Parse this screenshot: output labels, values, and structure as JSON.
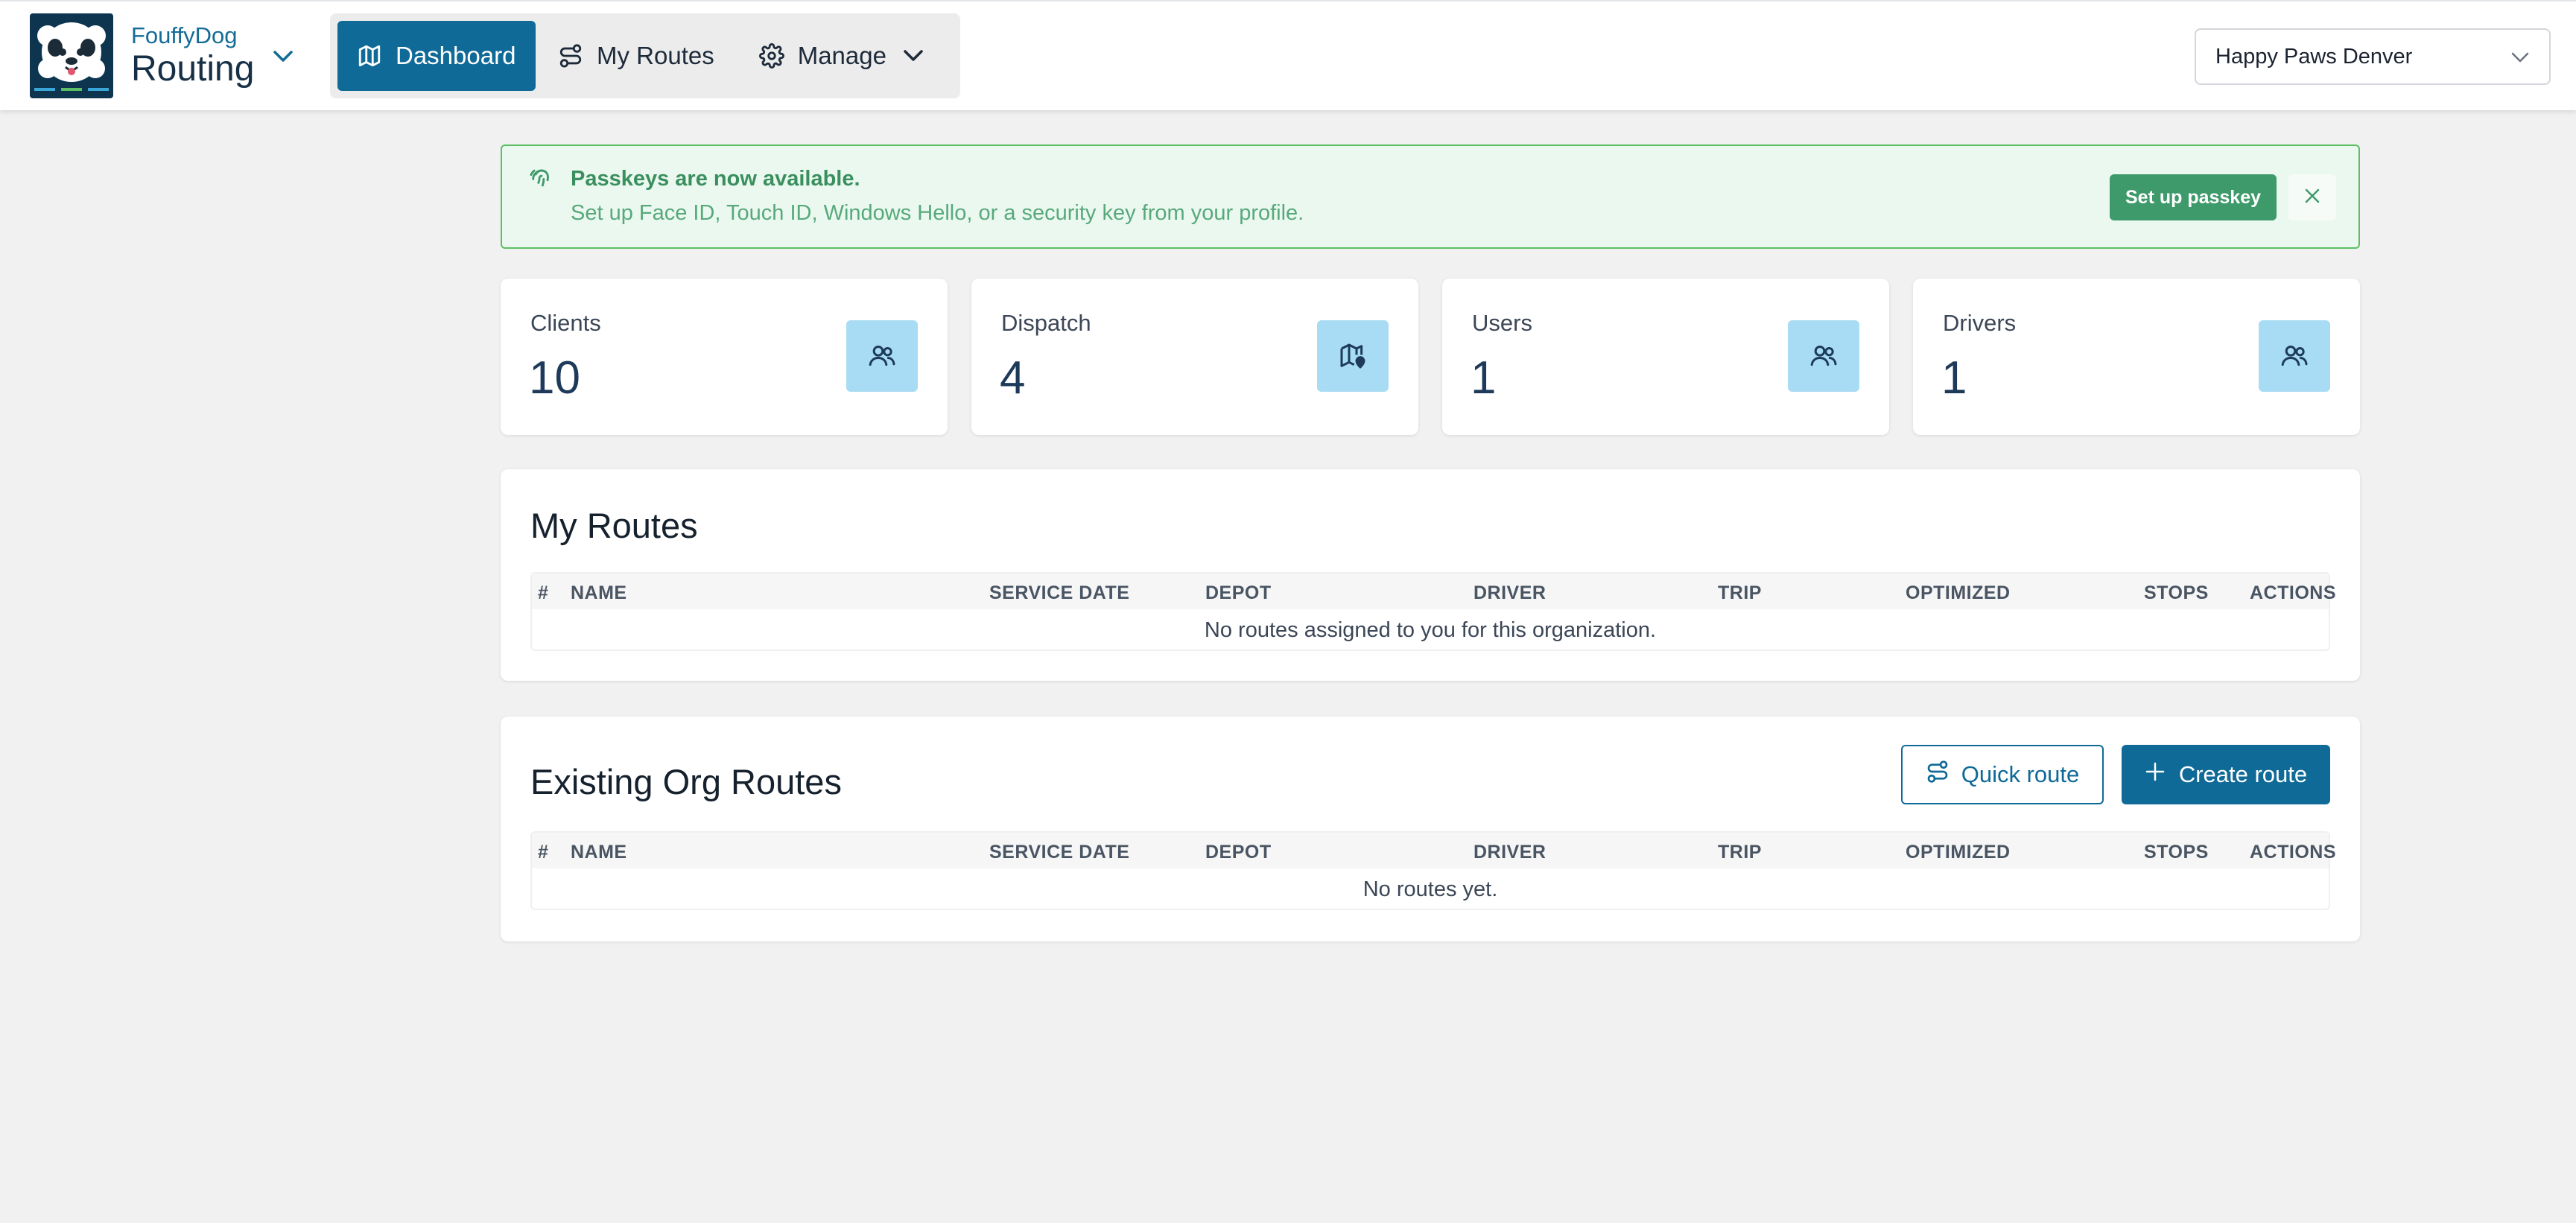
{
  "brand": {
    "name": "FouffyDog",
    "product": "Routing",
    "logo_icon": "dog-logo"
  },
  "nav": {
    "items": [
      {
        "label": "Dashboard",
        "icon": "map-icon",
        "active": true
      },
      {
        "label": "My Routes",
        "icon": "route-icon",
        "active": false
      },
      {
        "label": "Manage",
        "icon": "gear-icon",
        "active": false
      }
    ]
  },
  "org_select": {
    "value": "Happy Paws Denver"
  },
  "banner": {
    "title": "Passkeys are now available.",
    "text": "Set up Face ID, Touch ID, Windows Hello, or a security key from your profile.",
    "button": "Set up passkey",
    "icon": "fingerprint-icon",
    "color": "#3e9a6a"
  },
  "stats": [
    {
      "label": "Clients",
      "value": "10",
      "icon": "users-icon"
    },
    {
      "label": "Dispatch",
      "value": "4",
      "icon": "map-pin-icon"
    },
    {
      "label": "Users",
      "value": "1",
      "icon": "users-icon"
    },
    {
      "label": "Drivers",
      "value": "1",
      "icon": "users-icon"
    }
  ],
  "my_routes": {
    "title": "My Routes",
    "columns": [
      "#",
      "NAME",
      "SERVICE DATE",
      "DEPOT",
      "DRIVER",
      "TRIP",
      "OPTIMIZED",
      "STOPS",
      "ACTIONS"
    ],
    "empty": "No routes assigned to you for this organization."
  },
  "org_routes": {
    "title": "Existing Org Routes",
    "quick_route": "Quick route",
    "create_route": "Create route",
    "columns": [
      "#",
      "NAME",
      "SERVICE DATE",
      "DEPOT",
      "DRIVER",
      "TRIP",
      "OPTIMIZED",
      "STOPS",
      "ACTIONS"
    ],
    "empty": "No routes yet."
  },
  "colors": {
    "accent": "#0f6a97",
    "background": "#f0f1f0",
    "stat_icon_bg": "#a8dcf4"
  }
}
